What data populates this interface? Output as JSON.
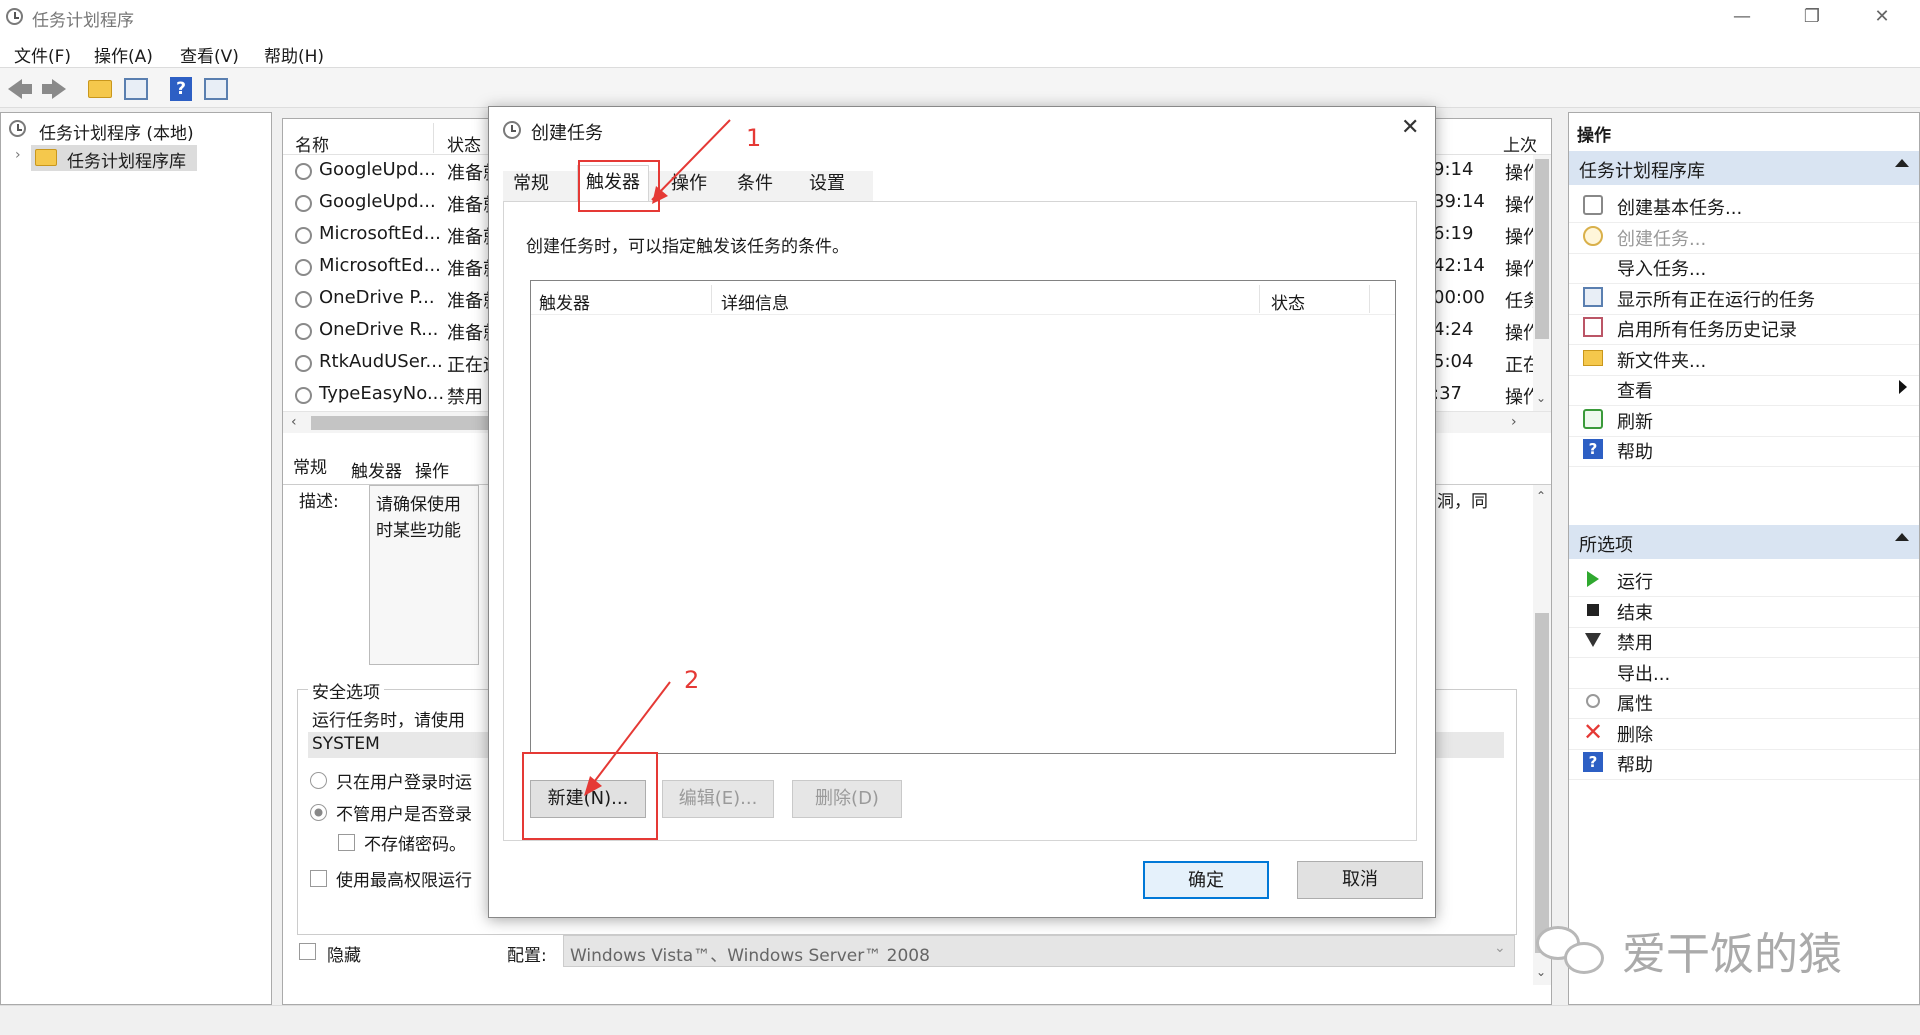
{
  "window": {
    "title": "任务计划程序"
  },
  "menu": [
    "文件(F)",
    "操作(A)",
    "查看(V)",
    "帮助(H)"
  ],
  "tree": {
    "root": "任务计划程序 (本地)",
    "child": "任务计划程序库"
  },
  "task_list": {
    "headers": {
      "name": "名称",
      "status": "状态",
      "last": "上次"
    },
    "rows": [
      {
        "name": "GoogleUpd...",
        "status": "准备就",
        "time": "9:14",
        "result": "操作"
      },
      {
        "name": "GoogleUpd...",
        "status": "准备就",
        "time": "39:14",
        "result": "操作"
      },
      {
        "name": "MicrosoftEd...",
        "status": "准备就",
        "time": "6:19",
        "result": "操作"
      },
      {
        "name": "MicrosoftEd...",
        "status": "准备就",
        "time": "42:14",
        "result": "操作"
      },
      {
        "name": "OneDrive P...",
        "status": "准备就",
        "time": "00:00",
        "result": "任务"
      },
      {
        "name": "OneDrive R...",
        "status": "准备就",
        "time": "4:24",
        "result": "操作"
      },
      {
        "name": "RtkAudUSer...",
        "status": "正在运",
        "time": "5:04",
        "result": "正在"
      },
      {
        "name": "TypeEasyNo...",
        "status": "禁用",
        "time": ":37",
        "result": "操作"
      }
    ]
  },
  "detail": {
    "tabs": [
      "常规",
      "触发器",
      "操作"
    ],
    "desc_label": "描述:",
    "desc_text_1": "请确保使用",
    "desc_text_2": "时某些功能",
    "desc_tail": "洞，同",
    "security_title": "安全选项",
    "run_as_label": "运行任务时，请使用",
    "run_as_user": "SYSTEM",
    "radio_1": "只在用户登录时运",
    "radio_2": "不管用户是否登录",
    "no_store_pwd": "不存储密码。",
    "highest": "使用最高权限运行",
    "hidden": "隐藏",
    "config_label": "配置:",
    "config_value": "Windows Vista™、Windows Server™ 2008"
  },
  "actions_pane": {
    "header": "操作",
    "group1": "任务计划程序库",
    "items1": [
      {
        "label": "创建基本任务...",
        "icon": "create-basic-task-icon",
        "disabled": false
      },
      {
        "label": "创建任务...",
        "icon": "create-task-icon",
        "disabled": true
      },
      {
        "label": "导入任务...",
        "icon": "",
        "disabled": false
      },
      {
        "label": "显示所有正在运行的任务",
        "icon": "running-tasks-icon",
        "disabled": false
      },
      {
        "label": "启用所有任务历史记录",
        "icon": "history-icon",
        "disabled": false
      },
      {
        "label": "新文件夹...",
        "icon": "folder-icon",
        "disabled": false
      },
      {
        "label": "查看",
        "icon": "",
        "disabled": false
      },
      {
        "label": "刷新",
        "icon": "refresh-icon",
        "disabled": false
      },
      {
        "label": "帮助",
        "icon": "help-icon",
        "disabled": false
      }
    ],
    "group2": "所选项",
    "items2": [
      {
        "label": "运行",
        "icon": "run-icon"
      },
      {
        "label": "结束",
        "icon": "stop-icon"
      },
      {
        "label": "禁用",
        "icon": "disable-icon"
      },
      {
        "label": "导出...",
        "icon": ""
      },
      {
        "label": "属性",
        "icon": "properties-icon"
      },
      {
        "label": "删除",
        "icon": "delete-icon"
      },
      {
        "label": "帮助",
        "icon": "help-icon"
      }
    ]
  },
  "dialog": {
    "title": "创建任务",
    "tabs": [
      "常规",
      "触发器",
      "操作",
      "条件",
      "设置"
    ],
    "active_tab": "触发器",
    "description": "创建任务时，可以指定触发该任务的条件。",
    "columns": [
      "触发器",
      "详细信息",
      "状态"
    ],
    "buttons": {
      "new": "新建(N)...",
      "edit": "编辑(E)...",
      "delete": "删除(D)"
    },
    "ok": "确定",
    "cancel": "取消"
  },
  "annotations": {
    "step1": "1",
    "step2": "2"
  },
  "watermark": "爱干饭的猿",
  "colors": {
    "accent": "#0078d7",
    "annotation": "#e53935",
    "group_header": "#d9e4f2"
  }
}
